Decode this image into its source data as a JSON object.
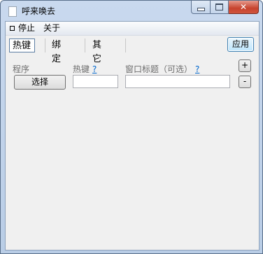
{
  "window": {
    "title": "呼来唤去",
    "close_glyph": "✕"
  },
  "menu": {
    "stop_label": "停止",
    "about_label": "关于"
  },
  "tabs": [
    "热键",
    "绑定",
    "其它"
  ],
  "toolbar": {
    "apply_label": "应用"
  },
  "form": {
    "program_label": "程序",
    "select_label": "选择",
    "hotkey_label": "热键",
    "window_title_label": "窗口标题（可选）",
    "help_mark": "?",
    "hotkey_value": "",
    "window_title_value": ""
  },
  "row_buttons": {
    "add_label": "+",
    "remove_label": "-"
  }
}
